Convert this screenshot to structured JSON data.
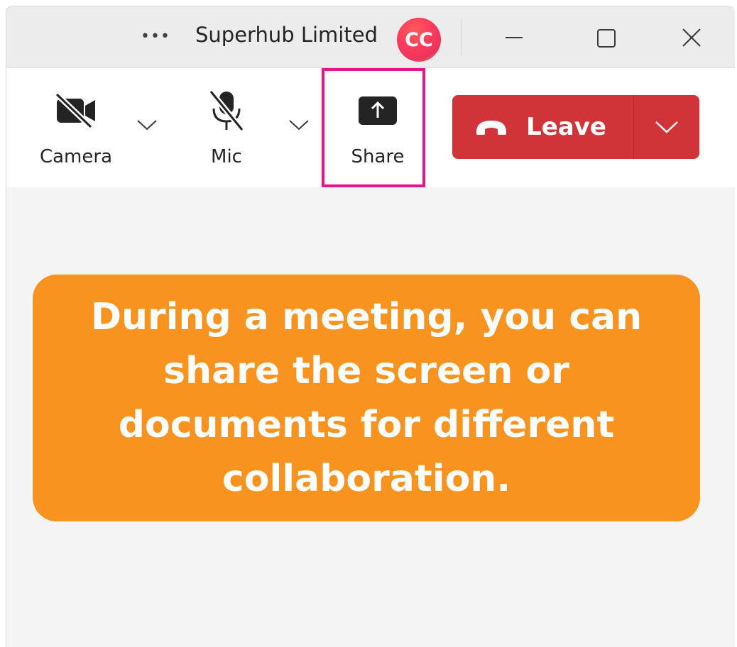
{
  "titlebar": {
    "more_label": "•••",
    "title": "Superhub Limited",
    "avatar_initials": "CC",
    "icons": [
      "more-icon",
      "minimize-icon",
      "maximize-icon",
      "close-icon"
    ]
  },
  "toolbar": {
    "camera": {
      "label": "Camera",
      "icon": "camera-off-icon"
    },
    "mic": {
      "label": "Mic",
      "icon": "mic-off-icon"
    },
    "share": {
      "label": "Share",
      "icon": "share-screen-icon",
      "highlighted": true
    },
    "leave": {
      "label": "Leave",
      "icon": "hang-up-icon"
    }
  },
  "colors": {
    "leave_red": "#d13438",
    "highlight_magenta": "#e3168a",
    "callout_orange": "#f7931e"
  },
  "callout": {
    "text": "During a meeting, you can share the screen or documents for different collaboration."
  }
}
